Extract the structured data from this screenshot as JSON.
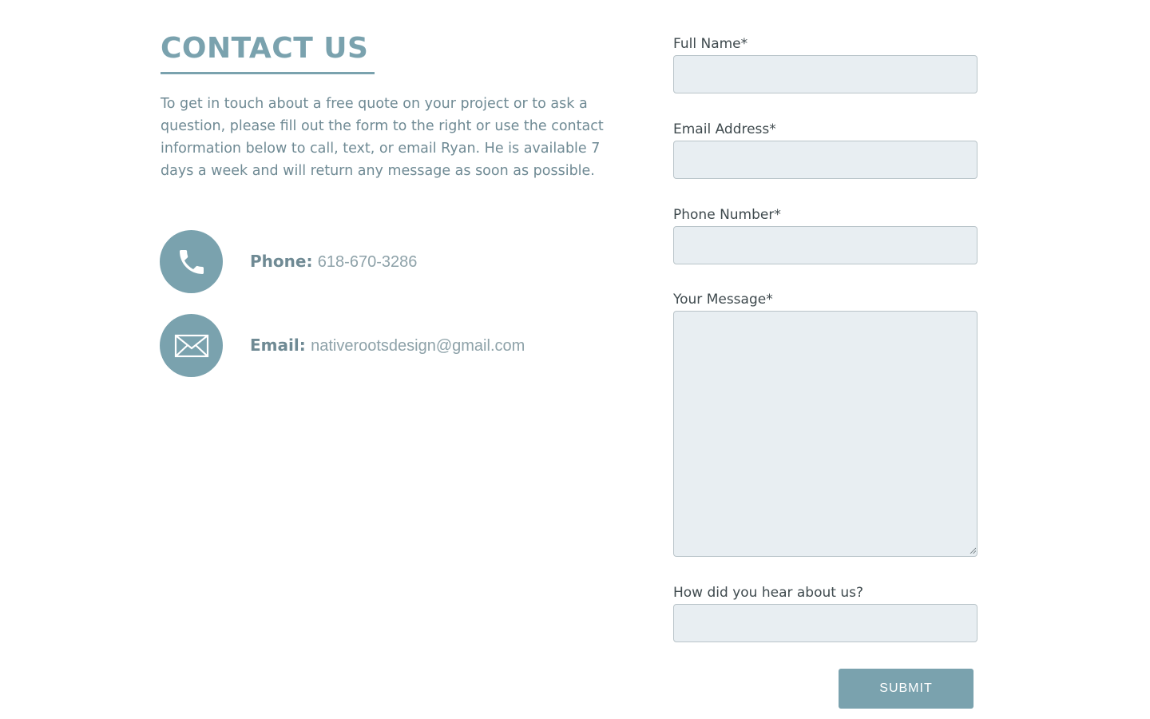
{
  "contact": {
    "title": "CONTACT US",
    "intro": "To get in touch about a free quote on your project or to ask a question, please fill out the form to the right or use the contact information below to call, text, or email Ryan. He is available 7 days a week and will return any message as soon as possible.",
    "phone": {
      "icon": "phone-icon",
      "label": "Phone:",
      "value": "618-670-3286"
    },
    "email": {
      "icon": "envelope-icon",
      "label": "Email:",
      "value": "nativerootsdesign@gmail.com"
    }
  },
  "form": {
    "full_name_label": "Full Name*",
    "full_name_value": "",
    "email_label": "Email Address*",
    "email_value": "",
    "phone_label": "Phone Number*",
    "phone_value": "",
    "message_label": "Your Message*",
    "message_value": "",
    "referral_label": "How did you hear about us?",
    "referral_value": "",
    "submit_label": "SUBMIT"
  },
  "colors": {
    "accent": "#7aa2ae",
    "field_bg": "#e8eef2",
    "field_border": "#b9c4c9",
    "body_text": "#6f8a94",
    "label_text": "#3f4a4e"
  }
}
